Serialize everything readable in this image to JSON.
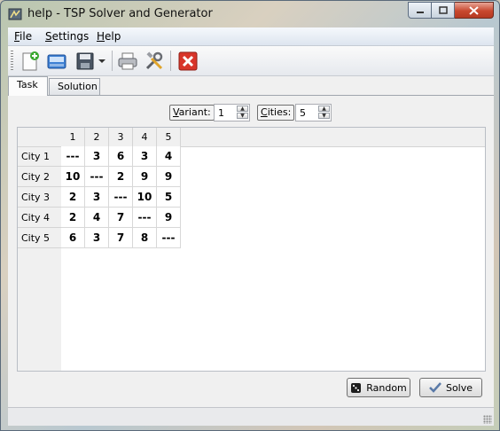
{
  "window": {
    "title": "help - TSP Solver and Generator"
  },
  "menu": [
    {
      "label": "File",
      "mnemonic": "F",
      "rest": "ile"
    },
    {
      "label": "Settings",
      "mnemonic": "S",
      "rest": "ettings"
    },
    {
      "label": "Help",
      "mnemonic": "H",
      "rest": "elp"
    }
  ],
  "toolbar": {
    "icons": [
      "new-file-icon",
      "open-icon",
      "save-icon",
      "save-dropdown-icon",
      "print-icon",
      "settings-tools-icon",
      "close-task-icon"
    ]
  },
  "tabs": [
    {
      "label": "Task",
      "active": true
    },
    {
      "label": "Solution",
      "active": false
    }
  ],
  "task": {
    "variant": {
      "label": "Variant:",
      "mnemonic": "V",
      "rest": "ariant:",
      "value": "1"
    },
    "cities": {
      "label": "Cities:",
      "mnemonic": "C",
      "rest": "ities:",
      "value": "5"
    },
    "columns": [
      "1",
      "2",
      "3",
      "4",
      "5"
    ],
    "rows": [
      {
        "name": "City 1",
        "cells": [
          "---",
          "3",
          "6",
          "3",
          "4"
        ]
      },
      {
        "name": "City 2",
        "cells": [
          "10",
          "---",
          "2",
          "9",
          "9"
        ]
      },
      {
        "name": "City 3",
        "cells": [
          "2",
          "3",
          "---",
          "10",
          "5"
        ]
      },
      {
        "name": "City 4",
        "cells": [
          "2",
          "4",
          "7",
          "---",
          "9"
        ]
      },
      {
        "name": "City 5",
        "cells": [
          "6",
          "3",
          "7",
          "8",
          "---"
        ]
      }
    ],
    "random_label": "Random",
    "solve_label": "Solve"
  },
  "colors": {
    "close_button": "#c8482e",
    "accent": "#2a62c8"
  }
}
